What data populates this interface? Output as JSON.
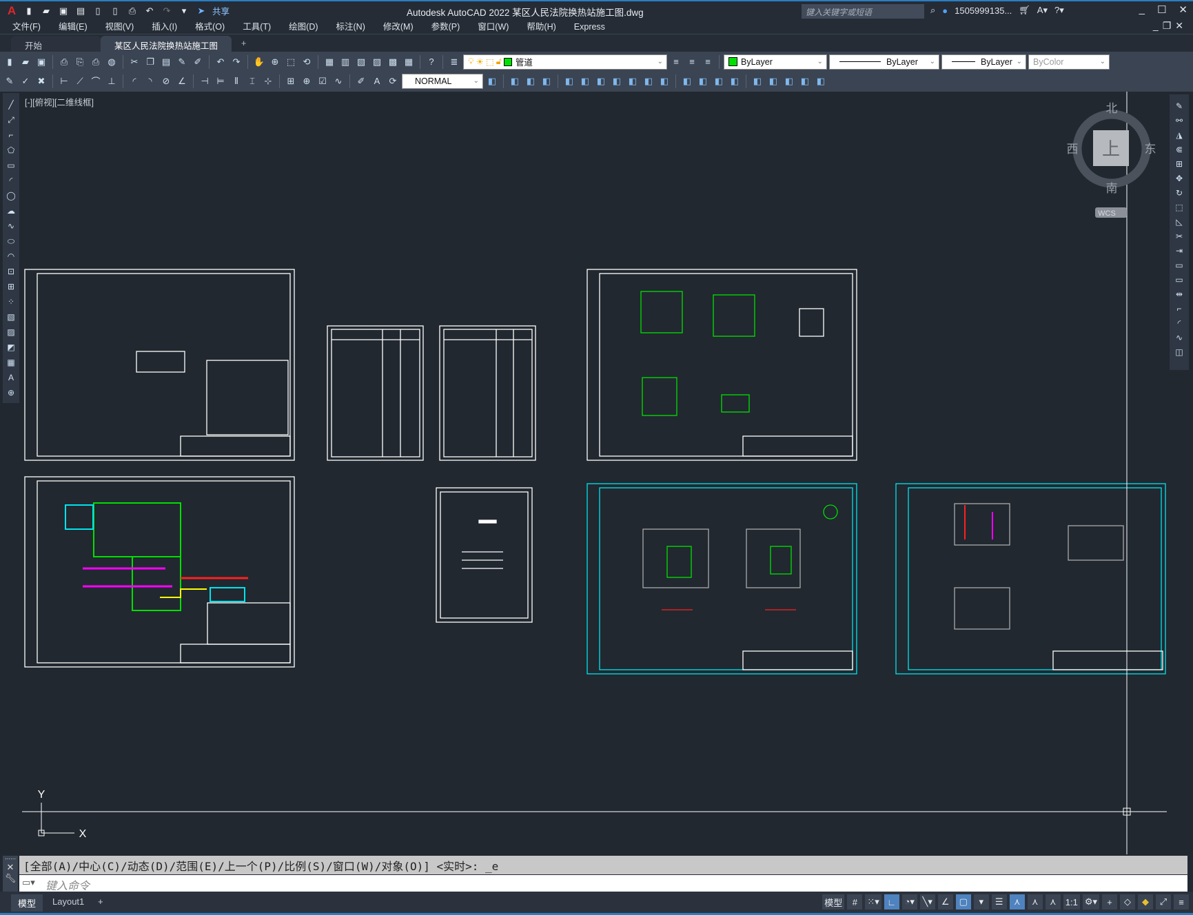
{
  "titlebar": {
    "app_title": "Autodesk AutoCAD 2022    某区人民法院换热站施工图.dwg",
    "share_label": "共享",
    "search_placeholder": "键入关键字或短语",
    "user": "1505999135...",
    "app_logo": "A"
  },
  "menu": [
    "文件(F)",
    "编辑(E)",
    "视图(V)",
    "插入(I)",
    "格式(O)",
    "工具(T)",
    "绘图(D)",
    "标注(N)",
    "修改(M)",
    "参数(P)",
    "窗口(W)",
    "帮助(H)",
    "Express"
  ],
  "tabs": {
    "start": "开始",
    "active": "某区人民法院换热站施工图*",
    "new": "+"
  },
  "toolbar": {
    "layer": "管道",
    "color": "ByLayer",
    "linetype": "ByLayer",
    "lineweight": "ByLayer",
    "plotstyle": "ByColor",
    "dimstyle": "NORMAL",
    "layer_color": "#00e000"
  },
  "viewport_label": "[-][俯视][二维线框]",
  "viewcube": {
    "north": "北",
    "south": "南",
    "east": "东",
    "west": "西",
    "face": "上",
    "wcs": "WCS"
  },
  "ucs": {
    "x": "X",
    "y": "Y"
  },
  "command": {
    "history": "[全部(A)/中心(C)/动态(D)/范围(E)/上一个(P)/比例(S)/窗口(W)/对象(O)] <实时>: _e",
    "placeholder": "键入命令"
  },
  "layout_tabs": [
    "模型",
    "Layout1",
    "+"
  ],
  "status": {
    "model": "模型",
    "scale": "1:1"
  },
  "colors": {
    "accent": "#2a7fc1",
    "canvas": "#212830",
    "cyan": "#00e5ee",
    "green": "#00e000",
    "magenta": "#ff00ff",
    "red": "#ff2020",
    "yellow": "#ffff00"
  }
}
